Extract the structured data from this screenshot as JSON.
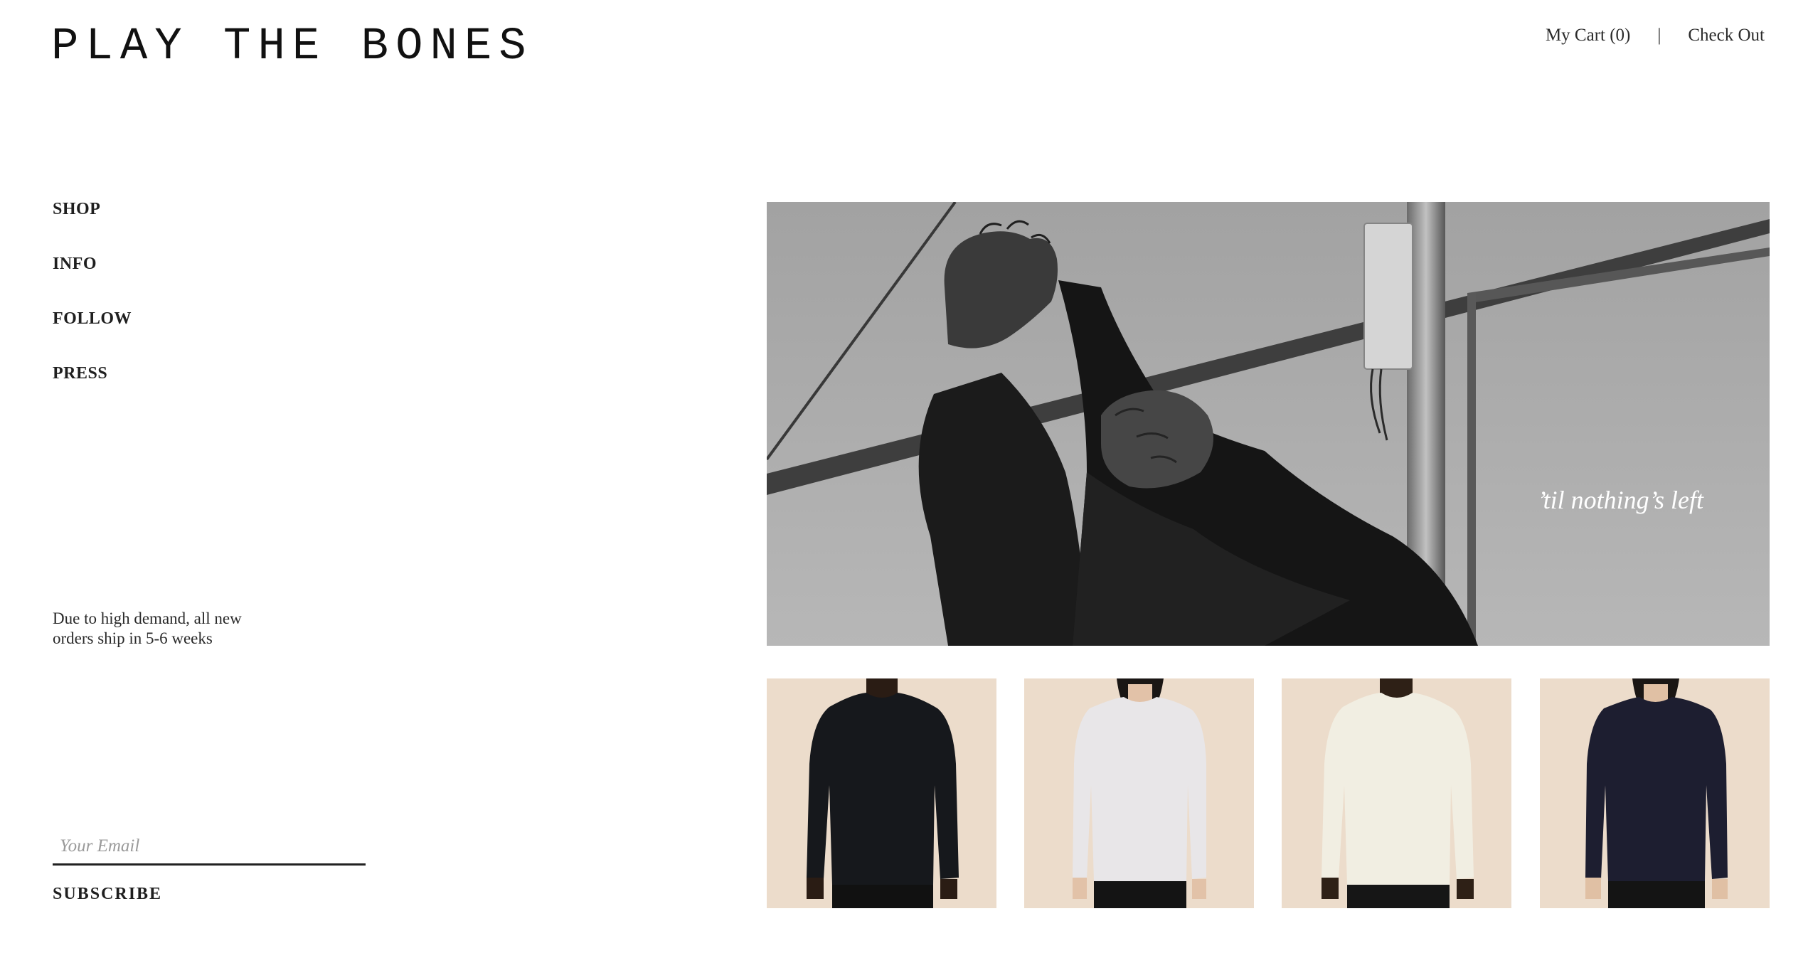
{
  "brand": {
    "logo_text": "PLAY THE BONES"
  },
  "header": {
    "cart_label": "My Cart (0)",
    "separator": "|",
    "checkout_label": "Check Out"
  },
  "nav": {
    "items": [
      {
        "label": "SHOP"
      },
      {
        "label": "INFO"
      },
      {
        "label": "FOLLOW"
      },
      {
        "label": "PRESS"
      }
    ]
  },
  "notice": {
    "text": "Due to high demand, all new orders ship in 5-6 weeks"
  },
  "newsletter": {
    "email_placeholder": "Your Email",
    "subscribe_label": "SUBSCRIBE"
  },
  "hero": {
    "caption": "’til nothing’s left"
  },
  "products": [
    {
      "sweater_color": "#16181c",
      "model_skin": "#2a1c14"
    },
    {
      "sweater_color": "#e8e6e8",
      "model_skin": "#e2c2a8"
    },
    {
      "sweater_color": "#f1eee2",
      "model_skin": "#2e2016"
    },
    {
      "sweater_color": "#1d1e30",
      "model_skin": "#e0c0a4"
    }
  ],
  "colors": {
    "text": "#1f1f1f",
    "product_background": "#ecdccb",
    "hero_sky": "#b4b4b4"
  }
}
